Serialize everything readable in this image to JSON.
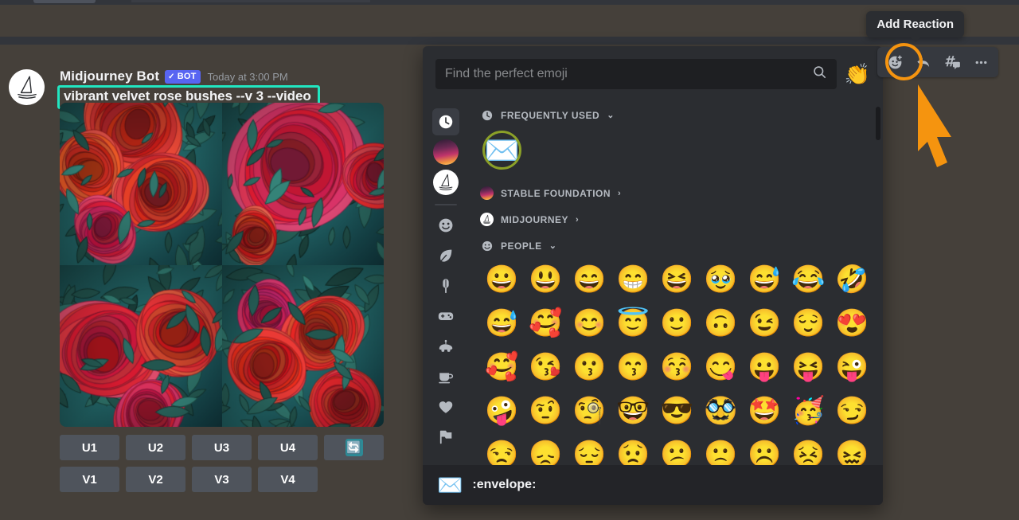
{
  "message": {
    "author": "Midjourney Bot",
    "bot_badge": "BOT",
    "bot_check": "✓",
    "timestamp": "Today at 3:00 PM",
    "prompt": "vibrant velvet rose bushes --v 3 --video",
    "prompt_highlight_color": "#21e6c1",
    "avatar_icon": "midjourney-sailboat-icon"
  },
  "upscale_buttons": [
    "U1",
    "U2",
    "U3",
    "U4"
  ],
  "variation_buttons": [
    "V1",
    "V2",
    "V3",
    "V4"
  ],
  "reroll_button": {
    "glyph": "🔄",
    "label": "reroll",
    "color": "#2d8a96"
  },
  "toolbar": {
    "tooltip": "Add Reaction",
    "highlight_color": "#f59410",
    "buttons": [
      {
        "name": "add-reaction-button",
        "icon": "smiley-plus-icon"
      },
      {
        "name": "reply-button",
        "icon": "reply-arrow-icon"
      },
      {
        "name": "create-thread-button",
        "icon": "thread-hash-icon"
      },
      {
        "name": "more-actions-button",
        "icon": "ellipsis-icon"
      }
    ]
  },
  "picker": {
    "search": {
      "placeholder": "Find the perfect emoji",
      "value": ""
    },
    "search_icon": "search-icon",
    "quick_emoji": "👏",
    "rail": [
      {
        "name": "rail-frequently-used",
        "icon": "clock-icon",
        "active": true
      },
      {
        "name": "rail-stable-foundation",
        "icon": "server-avatar"
      },
      {
        "name": "rail-midjourney",
        "icon": "midjourney-sailboat-icon"
      },
      {
        "name": "rail-people",
        "icon": "smiley-icon"
      },
      {
        "name": "rail-nature",
        "icon": "leaf-icon"
      },
      {
        "name": "rail-food",
        "icon": "popsicle-icon"
      },
      {
        "name": "rail-activities",
        "icon": "gamepad-icon"
      },
      {
        "name": "rail-travel",
        "icon": "vehicle-icon"
      },
      {
        "name": "rail-objects",
        "icon": "cup-icon"
      },
      {
        "name": "rail-symbols",
        "icon": "heart-icon"
      },
      {
        "name": "rail-flags",
        "icon": "flag-icon"
      }
    ],
    "sections": [
      {
        "label": "FREQUENTLY USED",
        "icon": "clock-icon",
        "caret": "⌄"
      },
      {
        "label": "STABLE FOUNDATION",
        "icon": "server-avatar",
        "caret": "›"
      },
      {
        "label": "MIDJOURNEY",
        "icon": "midjourney-sailboat-icon",
        "caret": "›"
      },
      {
        "label": "PEOPLE",
        "icon": "smiley-icon",
        "caret": "⌄"
      }
    ],
    "frequently_used": [
      "✉️"
    ],
    "selected_emoji_ring_color": "#8ba028",
    "people_rows": [
      [
        "😀",
        "😃",
        "😄",
        "😁",
        "😆",
        "🥹",
        "😅",
        "😂",
        "🤣"
      ],
      [
        "😅",
        "🥰",
        "😊",
        "😇",
        "🙂",
        "🙃",
        "😉",
        "😌",
        "😍"
      ],
      [
        "🥰",
        "😘",
        "😗",
        "😙",
        "😚",
        "😋",
        "😛",
        "😝",
        "😜"
      ],
      [
        "🤪",
        "🤨",
        "🧐",
        "🤓",
        "😎",
        "🥸",
        "🤩",
        "🥳",
        "😏"
      ],
      [
        "😒",
        "😞",
        "😔",
        "😟",
        "😕",
        "🙁",
        "☹️",
        "😣",
        "😖"
      ]
    ],
    "footer": {
      "emoji": "✉️",
      "name": ":envelope:"
    }
  }
}
